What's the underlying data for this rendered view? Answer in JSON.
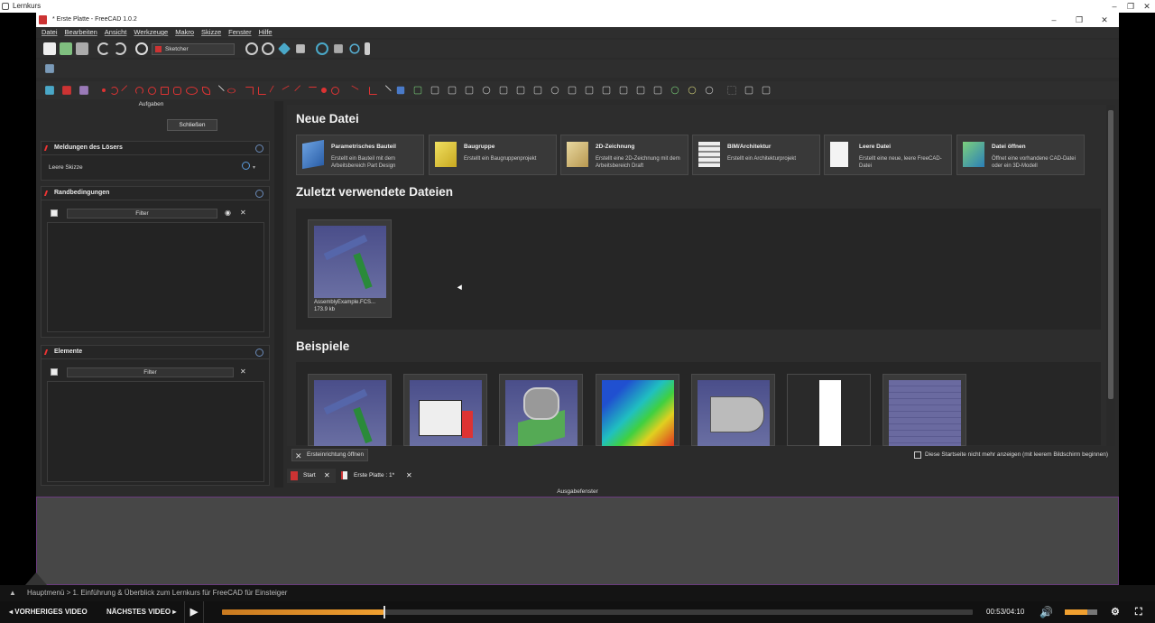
{
  "outer_window": {
    "title": "Lernkurs"
  },
  "app_window": {
    "title": "* Erste Platte - FreeCAD 1.0.2"
  },
  "menu": [
    "Datei",
    "Bearbeiten",
    "Ansicht",
    "Werkzeuge",
    "Makro",
    "Skizze",
    "Fenster",
    "Hilfe"
  ],
  "toolbar": {
    "workbench": "Sketcher"
  },
  "left_panel": {
    "tasks_label": "Aufgaben",
    "close_button": "Schließen",
    "solver": {
      "title": "Meldungen des Lösers",
      "message": "Leere Skizze"
    },
    "constraints": {
      "title": "Randbedingungen",
      "filter": "Filter"
    },
    "elements": {
      "title": "Elemente",
      "filter": "Filter"
    }
  },
  "start_page": {
    "new_file_heading": "Neue Datei",
    "cards": [
      {
        "title": "Parametrisches Bauteil",
        "desc": "Erstellt ein Bauteil mit dem Arbeitsbereich Part Design",
        "icon": "part-design-icon"
      },
      {
        "title": "Baugruppe",
        "desc": "Erstellt ein Baugruppenprojekt",
        "icon": "assembly-icon"
      },
      {
        "title": "2D-Zeichnung",
        "desc": "Erstellt eine 2D-Zeichnung mit dem Arbeitsbereich Draft",
        "icon": "draft-icon"
      },
      {
        "title": "BIM/Architektur",
        "desc": "Erstellt ein Architekturprojekt",
        "icon": "bim-icon"
      },
      {
        "title": "Leere Datei",
        "desc": "Erstellt eine neue, leere FreeCAD-Datei",
        "icon": "new-file-icon"
      },
      {
        "title": "Datei öffnen",
        "desc": "Öffnet eine vorhandene CAD-Datei oder ein 3D-Modell",
        "icon": "open-file-icon"
      }
    ],
    "recent_heading": "Zuletzt verwendete Dateien",
    "recent_files": [
      {
        "name": "AssemblyExample.FCS...",
        "size": "173.9 kb"
      }
    ],
    "examples_heading": "Beispiele",
    "first_start_button": "Ersteinrichtung öffnen",
    "dont_show_checkbox": "Diese Startseite nicht mehr anzeigen (mit leerem Bildschirm beginnen)"
  },
  "doc_tabs": [
    {
      "label": "Start"
    },
    {
      "label": "Erste Platte : 1*"
    }
  ],
  "output_panel": {
    "title": "Ausgabefenster"
  },
  "player": {
    "breadcrumb": "Hauptmenü > 1. Einführung & Überblick zum Lernkurs für FreeCAD für Einsteiger",
    "prev": "VORHERIGES VIDEO",
    "next": "NÄCHSTES VIDEO",
    "time": "00:53/04:10",
    "progress": 0.215
  },
  "colors": {
    "accent_red": "#dd3333",
    "progress": "#f0a030",
    "bg": "#2b2b2b"
  }
}
